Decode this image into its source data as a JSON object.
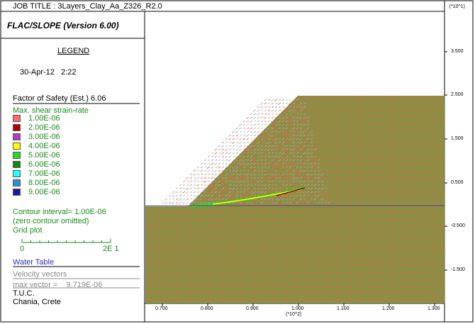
{
  "header": {
    "job_title": "JOB TITLE : 3Layers_Clay_Aa_Z326_R2.0",
    "y_exponent": "(*10^1)"
  },
  "app_title": "FLAC/SLOPE (Version 6.00)",
  "legend": {
    "title": "LEGEND",
    "date": "30-Apr-12",
    "time": "2:22",
    "factor_of_safety": "Factor of Safety (Est.)  6.06",
    "shear_title": "Max. shear strain-rate",
    "shear_levels": [
      {
        "label": "1.00E-06",
        "color": "#ff6b6b"
      },
      {
        "label": "2.00E-06",
        "color": "#b30000"
      },
      {
        "label": "3.00E-06",
        "color": "#b040c0"
      },
      {
        "label": "4.00E-06",
        "color": "#ffff00"
      },
      {
        "label": "5.00E-06",
        "color": "#22dd22"
      },
      {
        "label": "6.00E-06",
        "color": "#138a13"
      },
      {
        "label": "7.00E-06",
        "color": "#22ffff"
      },
      {
        "label": "8.00E-06",
        "color": "#2a8fd6"
      },
      {
        "label": "9.00E-06",
        "color": "#1a1aa8"
      }
    ],
    "contour_interval": "Contour interval=  1.00E-06",
    "zero_contour": "(zero contour omitted)",
    "grid_plot": "Grid plot",
    "scale_min": "0",
    "scale_max": "2E  1",
    "water_table": "Water Table",
    "velocity_vectors": "Velocity vectors",
    "max_vector_label": "max vector =",
    "max_vector_value": "9.719E-06",
    "org": "T.U.C.",
    "location": "Chania, Crete"
  },
  "axes": {
    "x_ticks": [
      "0.700",
      "0.800",
      "0.900",
      "1.000",
      "1.100",
      "1.200",
      "1.300"
    ],
    "x_exponent": "(*10^2)",
    "y_ticks": [
      "3.500",
      "2.500",
      "1.500",
      "0.500",
      "-0.500",
      "-1.500"
    ]
  },
  "colors": {
    "soil_fill": "#b07a4e",
    "grid_line": "#22cc22",
    "vector_grey": "#a8a8a8",
    "vector_red": "#ff5555",
    "legend_text": "#1a8a1a",
    "water_table": "#2d2db5"
  }
}
